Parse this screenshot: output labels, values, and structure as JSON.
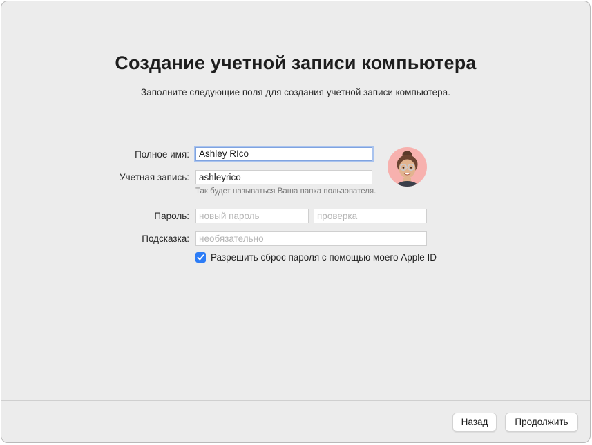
{
  "header": {
    "title": "Создание учетной записи компьютера",
    "subtitle": "Заполните следующие поля для создания учетной записи компьютера."
  },
  "form": {
    "full_name": {
      "label": "Полное имя:",
      "value": "Ashley RIco"
    },
    "account_name": {
      "label": "Учетная запись:",
      "value": "ashleyrico",
      "hint": "Так будет называться Ваша папка пользователя."
    },
    "password": {
      "label": "Пароль:",
      "placeholder": "новый пароль",
      "verify_placeholder": "проверка"
    },
    "password_hint": {
      "label": "Подсказка:",
      "placeholder": "необязательно"
    },
    "allow_reset": {
      "label": "Разрешить сброс пароля с помощью моего Apple ID",
      "checked": true
    },
    "avatar": {
      "icon": "memoji-avatar-icon"
    }
  },
  "footer": {
    "back_label": "Назад",
    "continue_label": "Продолжить"
  },
  "colors": {
    "window_bg": "#ececec",
    "accent": "#2c7cf6",
    "avatar_bg": "#f7b1ae"
  }
}
